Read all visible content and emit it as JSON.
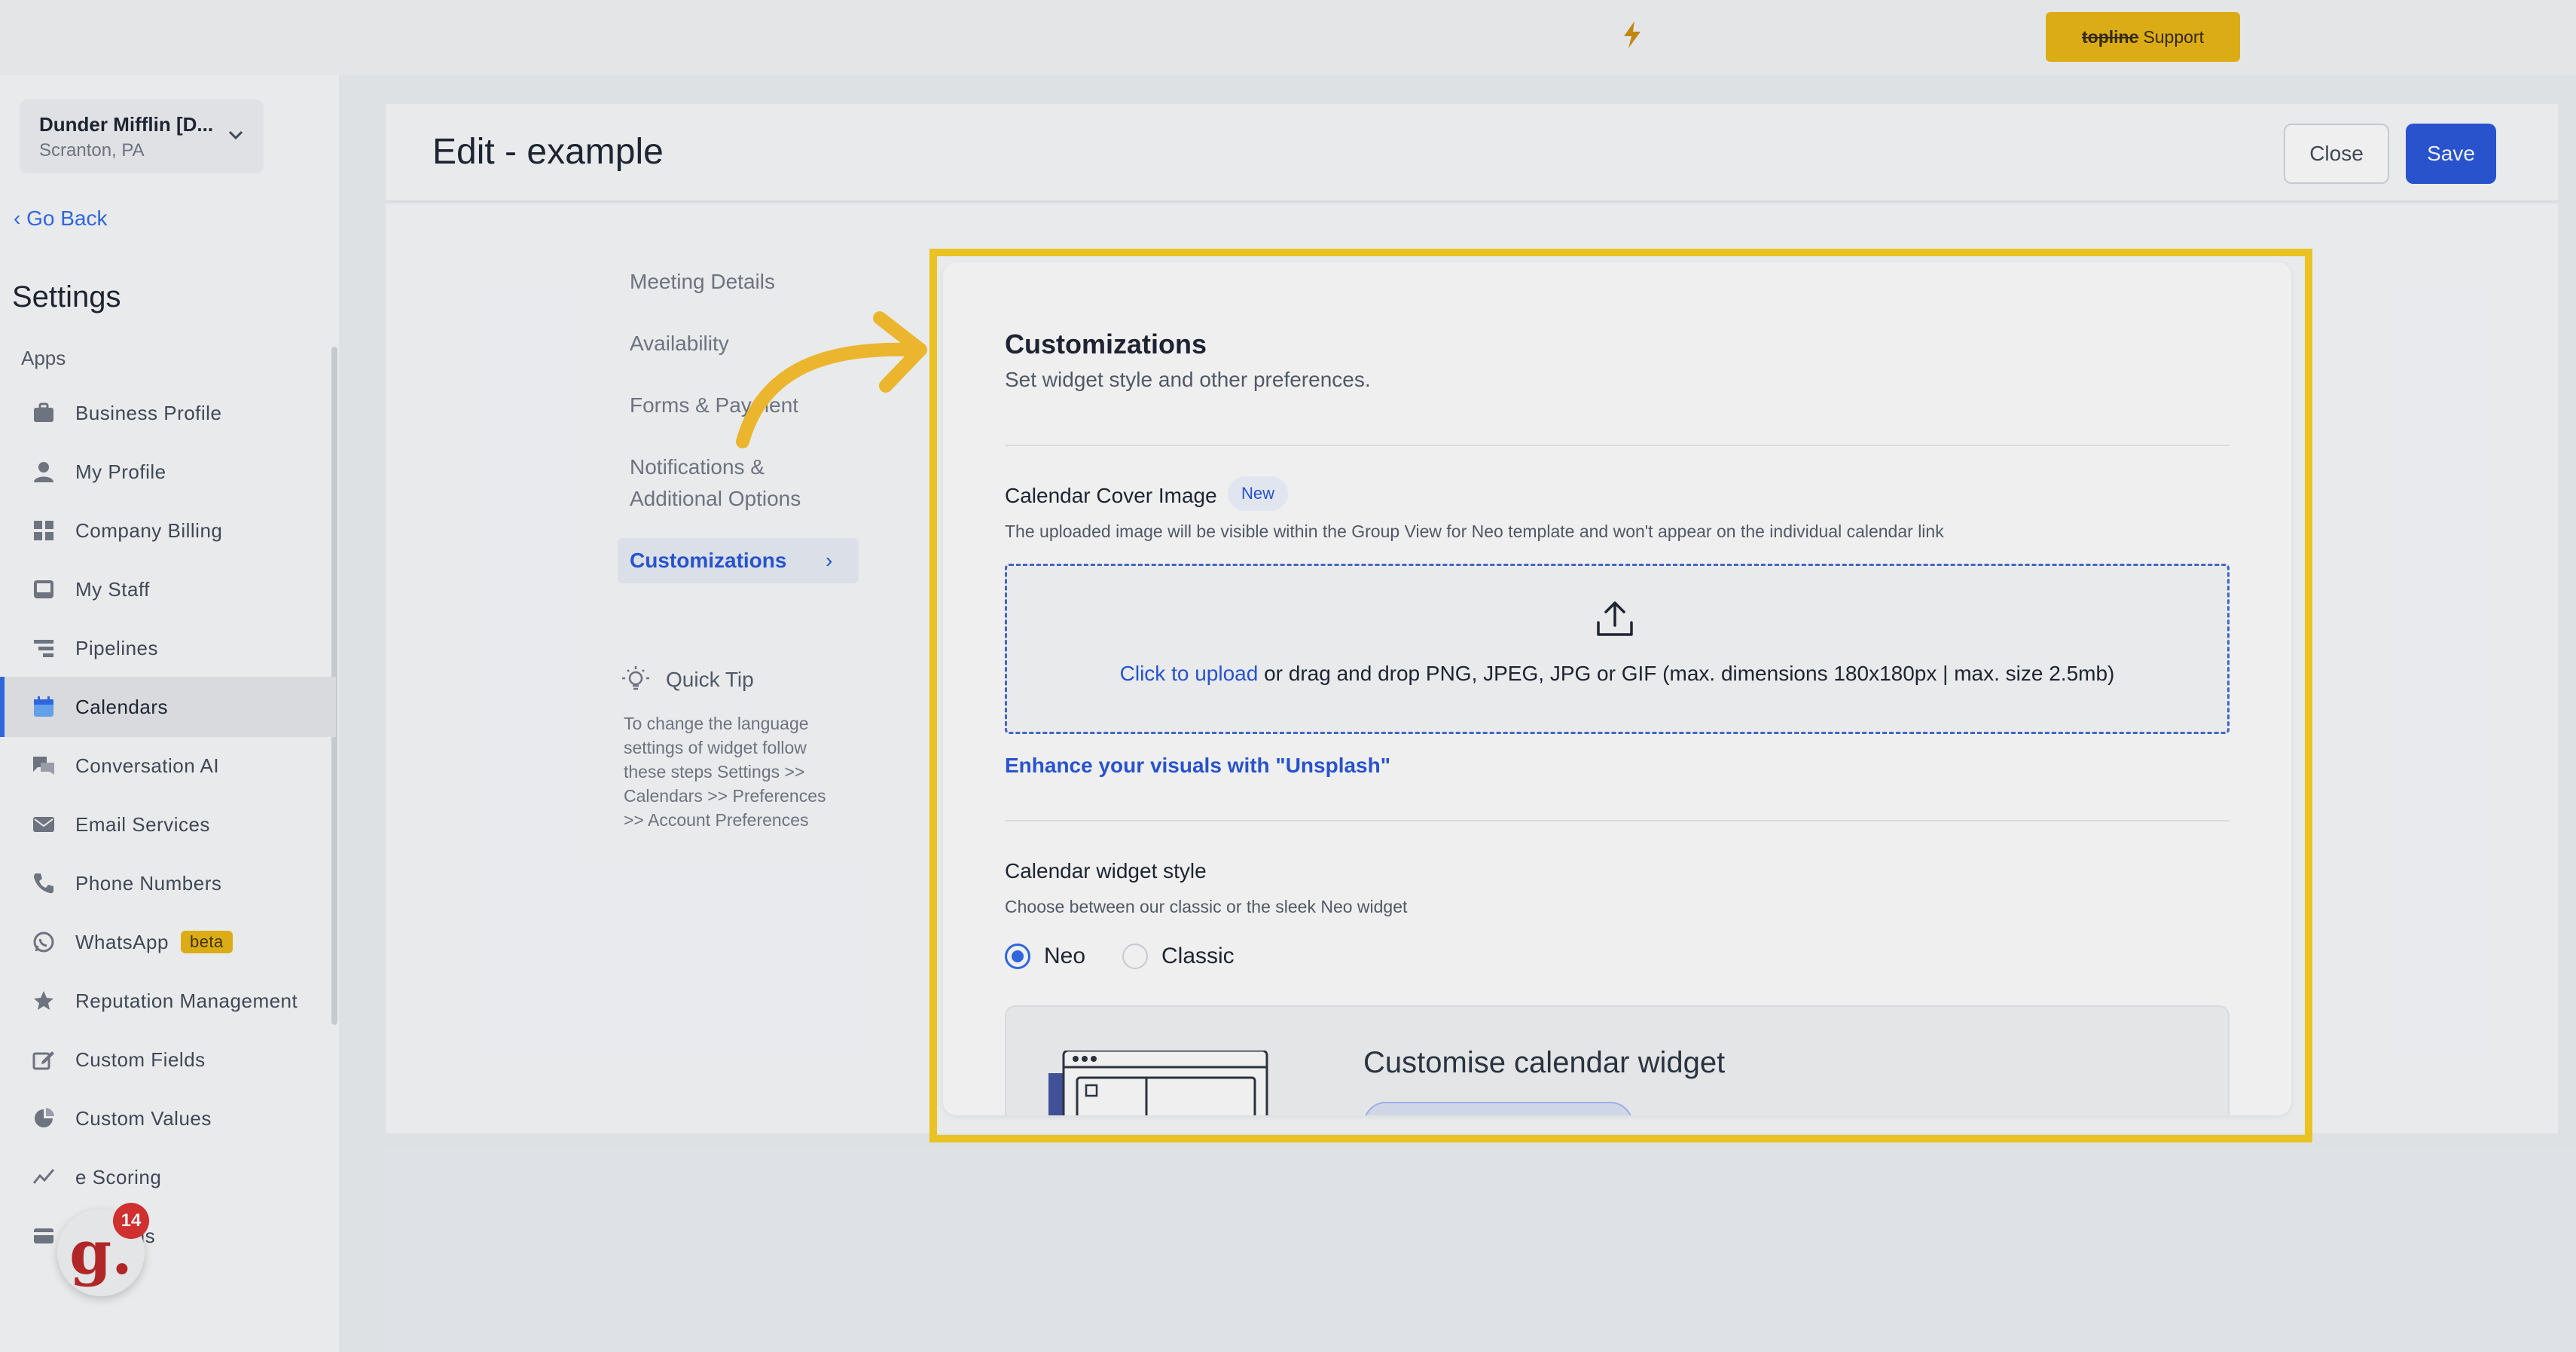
{
  "topbar": {
    "support_brand": "topline",
    "support_label": "Support"
  },
  "sidebar": {
    "location_name": "Dunder Mifflin [D...",
    "location_sub": "Scranton, PA",
    "go_back": "Go Back",
    "title": "Settings",
    "section": "Apps",
    "items": [
      {
        "label": "Business Profile",
        "icon": "briefcase-icon"
      },
      {
        "label": "My Profile",
        "icon": "user-icon"
      },
      {
        "label": "Company Billing",
        "icon": "grid-icon"
      },
      {
        "label": "My Staff",
        "icon": "staff-icon"
      },
      {
        "label": "Pipelines",
        "icon": "pipeline-icon"
      },
      {
        "label": "Calendars",
        "icon": "calendar-icon",
        "active": true
      },
      {
        "label": "Conversation AI",
        "icon": "chat-icon"
      },
      {
        "label": "Email Services",
        "icon": "mail-icon"
      },
      {
        "label": "Phone Numbers",
        "icon": "phone-icon"
      },
      {
        "label": "WhatsApp",
        "icon": "whatsapp-icon",
        "badge": "beta"
      },
      {
        "label": "Reputation Management",
        "icon": "star-icon"
      },
      {
        "label": "Custom Fields",
        "icon": "edit-icon"
      },
      {
        "label": "Custom Values",
        "icon": "pie-icon"
      },
      {
        "label": "e Scoring",
        "icon": "chart-icon"
      },
      {
        "label": "Domains",
        "icon": "domain-icon"
      }
    ]
  },
  "header": {
    "title": "Edit - example",
    "close_label": "Close",
    "save_label": "Save"
  },
  "subnav": {
    "items": [
      "Meeting Details",
      "Availability",
      "Forms & Payment",
      "Notifications &",
      "Additional Options",
      "Customizations"
    ]
  },
  "quick_tip": {
    "title": "Quick Tip",
    "text": "To change the language settings of widget follow these steps Settings >> Calendars >> Preferences >> Account Preferences"
  },
  "customizations": {
    "title": "Customizations",
    "subtitle": "Set widget style and other preferences.",
    "cover_label": "Calendar Cover Image",
    "new_badge": "New",
    "cover_desc": "The uploaded image will be visible within the Group View for Neo template and won't appear on the individual calendar link",
    "upload_link": "Click to upload",
    "upload_rest": " or drag and drop PNG, JPEG, JPG or GIF (max. dimensions 180x180px | max. size 2.5mb)",
    "unsplash": "Enhance your visuals with \"Unsplash\"",
    "style_label": "Calendar widget style",
    "style_desc": "Choose between our classic or the sleek Neo widget",
    "options": [
      "Neo",
      "Classic"
    ],
    "selected_option": "Neo",
    "promo_title": "Customise calendar widget"
  },
  "notification_badge": {
    "count": "14",
    "letter": "g."
  },
  "colors": {
    "accent": "#1d4ed8",
    "highlight": "#facc15",
    "arrow": "#fbbf24"
  }
}
